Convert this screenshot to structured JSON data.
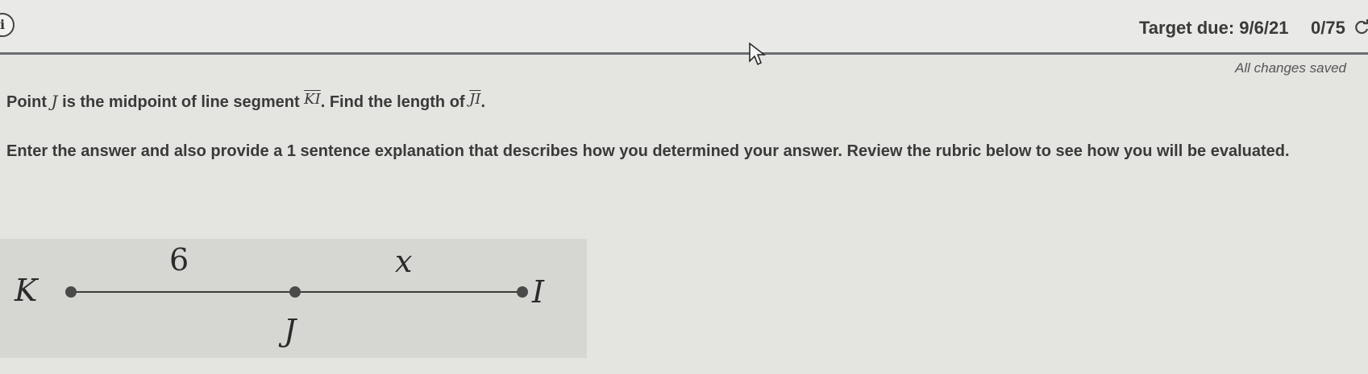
{
  "header": {
    "info_icon": "i",
    "target_due": "Target due: 9/6/21",
    "score": "0/75",
    "save_status": "All changes saved"
  },
  "question": {
    "line1_prefix": "Point ",
    "line1_point": "J",
    "line1_mid": " is the midpoint of line segment ",
    "segment1": "KI",
    "line1_mid2": ". Find the length of ",
    "segment2": "JI",
    "line1_end": ".",
    "instructions": "Enter the answer and also provide a 1 sentence explanation that describes how you determined your answer. Review the rubric below to see how you will be evaluated."
  },
  "figure": {
    "label_k": "K",
    "label_j": "J",
    "label_i": "I",
    "length_kj": "6",
    "length_ji": "x"
  }
}
